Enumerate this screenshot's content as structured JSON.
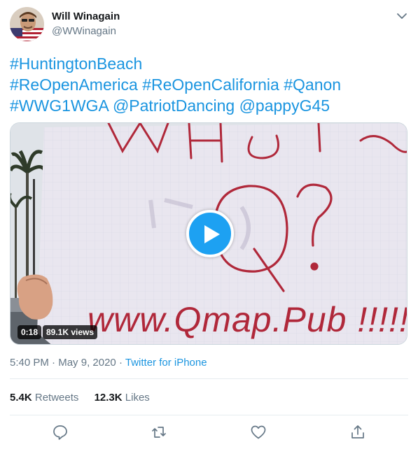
{
  "author": {
    "name": "Will Winagain",
    "handle": "@WWinagain"
  },
  "tweet": {
    "hashtags_line1": [
      "#HuntingtonBeach"
    ],
    "hashtags_line2": [
      "#ReOpenAmerica",
      "#ReOpenCalifornia",
      "#Qanon"
    ],
    "hashtags_line3": [
      "#WWG1WGA",
      "@PatriotDancing",
      "@pappyG45"
    ]
  },
  "media": {
    "sign_text_bottom": "www.Qmap.Pub !!!!!",
    "sign_text_middle": "Q?",
    "duration": "0:18",
    "views": "89.1K views"
  },
  "meta": {
    "time": "5:40 PM",
    "separator": "·",
    "date": "May 9, 2020",
    "source": "Twitter for iPhone"
  },
  "stats": {
    "retweets_count": "5.4K",
    "retweets_label": "Retweets",
    "likes_count": "12.3K",
    "likes_label": "Likes"
  },
  "icons": {
    "caret": "chevron-down-icon",
    "reply": "reply-icon",
    "retweet": "retweet-icon",
    "like": "heart-icon",
    "share": "share-icon",
    "play": "play-icon"
  },
  "colors": {
    "accent": "#1b95e0",
    "play_button": "#1da1f2",
    "secondary_text": "#657786",
    "sign_ink": "#b0283a"
  }
}
